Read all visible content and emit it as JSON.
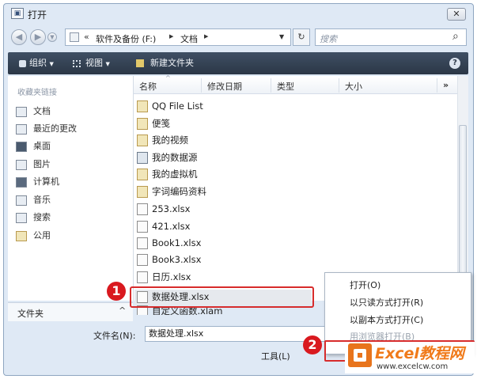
{
  "window": {
    "title": "打开",
    "close_symbol": "✕"
  },
  "address": {
    "back_symbol": "◀",
    "forward_symbol": "▶",
    "overflow": "«",
    "crumbs": [
      "软件及备份 (F:)",
      "文档"
    ],
    "sep": "▶",
    "dropdown": "▼",
    "refresh_symbol": "↻",
    "search_placeholder": "搜索",
    "search_symbol": "⌕"
  },
  "toolbar": {
    "organize": "组织",
    "views": "视图",
    "new_folder": "新建文件夹",
    "help": "?",
    "caret": "▼"
  },
  "nav": {
    "heading": "收藏夹链接",
    "items": [
      "文档",
      "最近的更改",
      "桌面",
      "图片",
      "计算机",
      "音乐",
      "搜索",
      "公用"
    ],
    "folders_label": "文件夹",
    "folders_caret": "^"
  },
  "columns": {
    "name": "名称",
    "modified": "修改日期",
    "type": "类型",
    "size": "大小",
    "more": "»",
    "sort_caret": "^"
  },
  "files": [
    {
      "name": "QQ File List",
      "kind": "folder"
    },
    {
      "name": "便笺",
      "kind": "folder"
    },
    {
      "name": "我的视频",
      "kind": "folder"
    },
    {
      "name": "我的数据源",
      "kind": "source"
    },
    {
      "name": "我的虚拟机",
      "kind": "folder"
    },
    {
      "name": "字词编码资料",
      "kind": "folder"
    },
    {
      "name": "253.xlsx",
      "kind": "xlsx"
    },
    {
      "name": "421.xlsx",
      "kind": "xlsx"
    },
    {
      "name": "Book1.xlsx",
      "kind": "xlsx"
    },
    {
      "name": "Book3.xlsx",
      "kind": "xlsx"
    },
    {
      "name": "日历.xlsx",
      "kind": "xlsx"
    },
    {
      "name": "数据处理.xlsx",
      "kind": "xlsx"
    },
    {
      "name": "自定义函数.xlam",
      "kind": "xlsx"
    }
  ],
  "footer": {
    "filename_label": "文件名(N):",
    "filename_value": "数据处理.xlsx",
    "tools_label": "工具(L)"
  },
  "context_menu": {
    "items": [
      "打开(O)",
      "以只读方式打开(R)",
      "以副本方式打开(C)",
      "用浏览器打开(B)"
    ],
    "disabled_index": 3
  },
  "badges": [
    "1",
    "2"
  ],
  "watermark": {
    "brand": "Excel教程网",
    "url": "www.excelcw.com"
  },
  "colors": {
    "highlight": "#d72c2c",
    "toolbar": "#2f3b4c",
    "accent": "#f07a1a"
  }
}
